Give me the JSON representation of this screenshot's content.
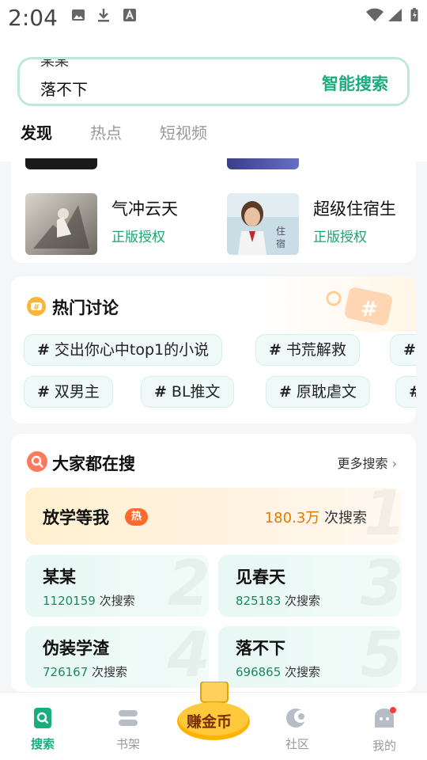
{
  "status_bar": {
    "time": "2:04"
  },
  "search": {
    "rotating_prev": "某某",
    "rotating_current": "落不下",
    "action": "智能搜索"
  },
  "tabs": [
    {
      "label": "发现"
    },
    {
      "label": "热点"
    },
    {
      "label": "短视频"
    }
  ],
  "books": [
    {
      "title": "气冲云天",
      "tag": "正版授权"
    },
    {
      "title": "超级住宿生",
      "tag": "正版授权"
    }
  ],
  "hot_discussion": {
    "title": "热门讨论",
    "tags": [
      {
        "label": "交出你心中top1的小说"
      },
      {
        "label": "书荒解救"
      },
      {
        "label": "双男主"
      },
      {
        "label": "BL推文"
      },
      {
        "label": "原耽虐文"
      }
    ]
  },
  "everyone_searching": {
    "title": "大家都在搜",
    "more": "更多搜索",
    "top": {
      "name": "放学等我",
      "badge": "热",
      "count": "180.3万",
      "suffix": "次搜索"
    },
    "items": [
      {
        "rank": "2",
        "name": "某某",
        "count": "1120159",
        "suffix": "次搜索"
      },
      {
        "rank": "3",
        "name": "见春天",
        "count": "825183",
        "suffix": "次搜索"
      },
      {
        "rank": "4",
        "name": "伪装学渣",
        "count": "726167",
        "suffix": "次搜索"
      },
      {
        "rank": "5",
        "name": "落不下",
        "count": "696865",
        "suffix": "次搜索"
      }
    ],
    "top_rank": "1"
  },
  "nav": [
    {
      "label": "搜索"
    },
    {
      "label": "书架"
    },
    {
      "label": "赚金币"
    },
    {
      "label": "社区"
    },
    {
      "label": "我的"
    }
  ],
  "colors": {
    "accent": "#1aae7e",
    "hot_orange": "#ff6a2c"
  }
}
